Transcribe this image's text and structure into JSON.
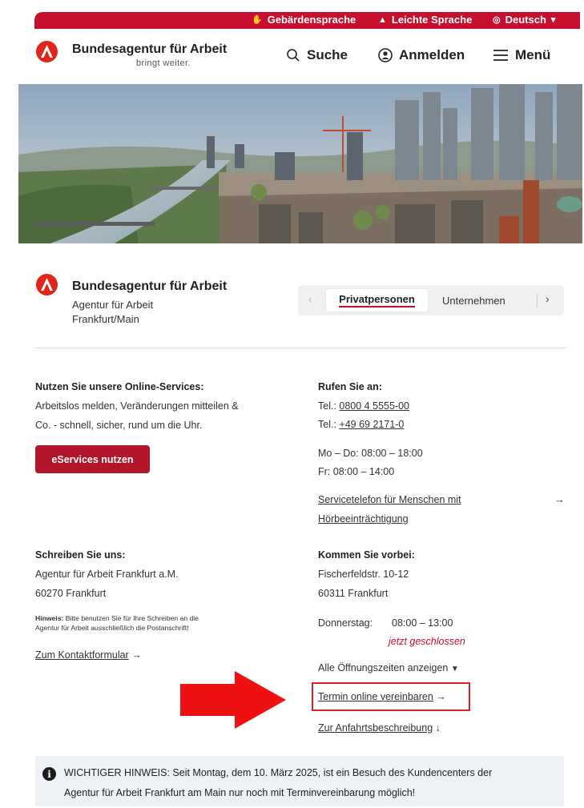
{
  "topbar": {
    "sign_language": "Gebärdensprache",
    "easy_language": "Leichte Sprache",
    "language": "Deutsch"
  },
  "header": {
    "brand_name": "Bundesagentur für Arbeit",
    "brand_tagline": "bringt weiter.",
    "search_label": "Suche",
    "login_label": "Anmelden",
    "menu_label": "Menü"
  },
  "agency": {
    "name": "Bundesagentur für Arbeit",
    "line2": "Agentur für Arbeit",
    "line3": "Frankfurt/Main"
  },
  "tabs": {
    "active": "Privatpersonen",
    "other": "Unternehmen"
  },
  "online": {
    "heading": "Nutzen Sie unsere Online-Services:",
    "line1": "Arbeitslos melden, Veränderungen mitteilen &",
    "line2": "Co. - schnell, sicher, rund um die Uhr.",
    "button": "eServices nutzen"
  },
  "call": {
    "heading": "Rufen Sie an:",
    "tel1_prefix": "Tel.: ",
    "tel1": "0800 4 5555-00",
    "tel2_prefix": "Tel.: ",
    "tel2": "+49 69 2171-0",
    "hours1": "Mo – Do: 08:00 – 18:00",
    "hours2": "Fr: 08:00 – 14:00",
    "hearing_link_1": "Servicetelefon für Menschen mit",
    "hearing_link_2": "Hörbeeinträchtigung"
  },
  "write": {
    "heading": "Schreiben Sie uns:",
    "line1": "Agentur für Arbeit Frankfurt a.M.",
    "line2": "60270 Frankfurt",
    "hint_label": "Hinweis:",
    "hint_1": " Bitte benutzen Sie für Ihre Schreiben an die",
    "hint_2": "Agentur für Arbeit ausschließlich die Postanschrift!",
    "contact_link": "Zum Kontaktformular"
  },
  "visit": {
    "heading": "Kommen Sie vorbei:",
    "street": "Fischerfeldstr. 10-12",
    "city": "60311 Frankfurt",
    "day": "Donnerstag:",
    "hours": "08:00 – 13:00",
    "status": "jetzt geschlossen",
    "all_hours": "Alle Öffnungszeiten anzeigen",
    "appointment_link": "Termin online vereinbaren",
    "directions_link": "Zur Anfahrtsbeschreibung"
  },
  "notice": {
    "line1": "WICHTIGER HINWEIS: Seit Montag, dem 10. März 2025, ist ein Besuch des Kundencenters der",
    "line2": "Agentur für Arbeit Frankfurt am Main nur noch mit Terminvereinbarung möglich!"
  },
  "colors": {
    "brand_red": "#c8102e",
    "button_red": "#b3152b",
    "annotation_red": "#e02020",
    "notice_bg": "#eef1f5"
  }
}
